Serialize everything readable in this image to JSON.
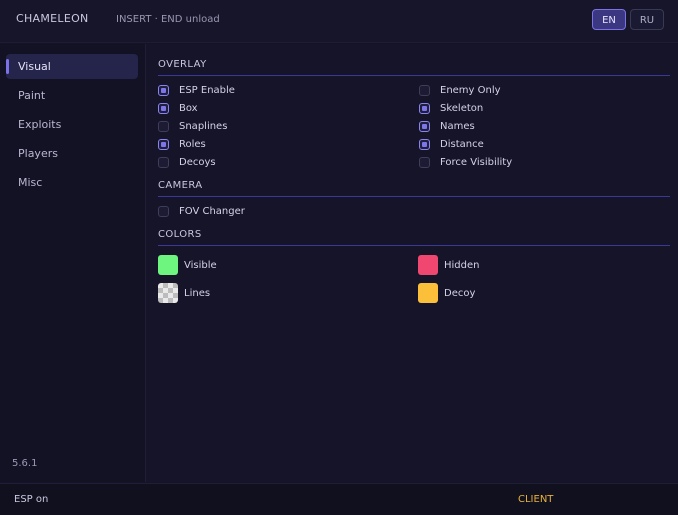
{
  "header": {
    "title": "CHAMELEON",
    "hotkeys": "INSERT · END unload",
    "languages": [
      {
        "label": "EN",
        "active": true
      },
      {
        "label": "RU",
        "active": false
      }
    ]
  },
  "sidebar": {
    "items": [
      {
        "label": "Visual",
        "active": true
      },
      {
        "label": "Paint",
        "active": false
      },
      {
        "label": "Exploits",
        "active": false
      },
      {
        "label": "Players",
        "active": false
      },
      {
        "label": "Misc",
        "active": false
      }
    ],
    "version": "5.6.1"
  },
  "overlay": {
    "title": "OVERLAY",
    "left": [
      {
        "label": "ESP Enable",
        "checked": true
      },
      {
        "label": "Box",
        "checked": true
      },
      {
        "label": "Snaplines",
        "checked": false
      },
      {
        "label": "Roles",
        "checked": true
      },
      {
        "label": "Decoys",
        "checked": false
      }
    ],
    "right": [
      {
        "label": "Enemy Only",
        "checked": false
      },
      {
        "label": "Skeleton",
        "checked": true
      },
      {
        "label": "Names",
        "checked": true
      },
      {
        "label": "Distance",
        "checked": true
      },
      {
        "label": "Force Visibility",
        "checked": false
      }
    ]
  },
  "camera": {
    "title": "CAMERA",
    "items": [
      {
        "label": "FOV Changer",
        "checked": false
      }
    ]
  },
  "colors": {
    "title": "COLORS",
    "items": [
      {
        "label": "Visible",
        "color": "#6ef57f",
        "pattern": "solid"
      },
      {
        "label": "Hidden",
        "color": "#ef476f",
        "pattern": "solid"
      },
      {
        "label": "Lines",
        "color": "#e0e0e0",
        "pattern": "checker"
      },
      {
        "label": "Decoy",
        "color": "#fbbf3a",
        "pattern": "solid"
      }
    ]
  },
  "footer": {
    "status": "ESP on",
    "client_label": "CLIENT",
    "client_color": "#e8b23a"
  },
  "theme": {
    "accent": "#7a72e6",
    "section_line": "#3c3897"
  }
}
